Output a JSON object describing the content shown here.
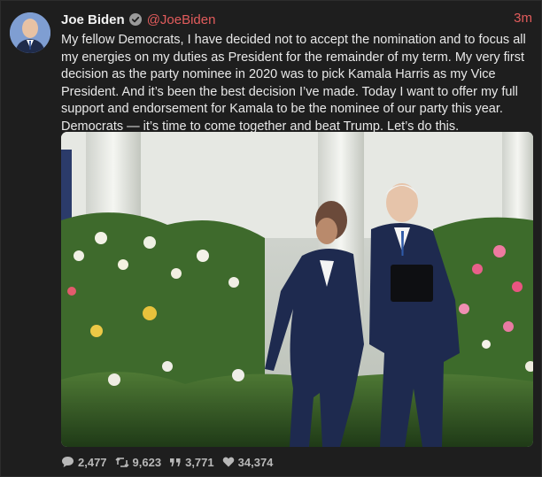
{
  "tweet": {
    "display_name": "Joe Biden",
    "handle": "@JoeBiden",
    "timestamp": "3m",
    "text": "My fellow Democrats, I have decided not to accept the nomination and to focus all my energies on my duties as President for the remainder of my term. My very first decision as the party nominee in 2020 was to pick Kamala Harris as my Vice President. And it’s been the best decision I’ve made. Today I want to offer my full support and endorsement for Kamala to be the nominee of our party this year. Democrats — it’s time to come together and beat Trump. Let’s do this.",
    "verified_icon": "verified-check-icon"
  },
  "stats": {
    "replies": "2,477",
    "retweets": "9,623",
    "quotes": "3,771",
    "likes": "34,374"
  },
  "colors": {
    "background": "#1e1e1e",
    "accent": "#e25c5c",
    "text": "#e8e8e8",
    "muted": "#b8b8b8"
  }
}
